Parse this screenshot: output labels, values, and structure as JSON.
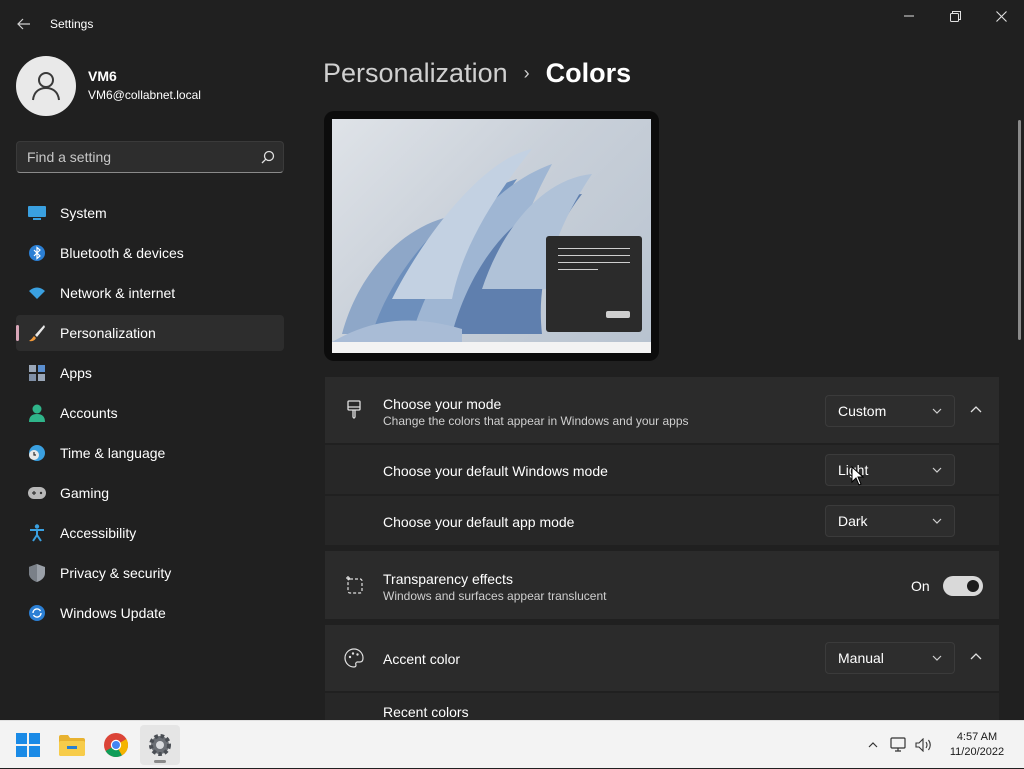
{
  "window": {
    "title": "Settings"
  },
  "user": {
    "name": "VM6",
    "email": "VM6@collabnet.local"
  },
  "search": {
    "placeholder": "Find a setting"
  },
  "sidebar": {
    "items": [
      {
        "label": "System",
        "icon": "monitor-icon"
      },
      {
        "label": "Bluetooth & devices",
        "icon": "bluetooth-icon"
      },
      {
        "label": "Network & internet",
        "icon": "wifi-icon"
      },
      {
        "label": "Personalization",
        "icon": "brush-icon",
        "selected": true
      },
      {
        "label": "Apps",
        "icon": "apps-icon"
      },
      {
        "label": "Accounts",
        "icon": "person-icon"
      },
      {
        "label": "Time & language",
        "icon": "clock-globe-icon"
      },
      {
        "label": "Gaming",
        "icon": "gamepad-icon"
      },
      {
        "label": "Accessibility",
        "icon": "accessibility-icon"
      },
      {
        "label": "Privacy & security",
        "icon": "shield-icon"
      },
      {
        "label": "Windows Update",
        "icon": "update-icon"
      }
    ]
  },
  "breadcrumb": {
    "parent": "Personalization",
    "separator": "›",
    "current": "Colors"
  },
  "settings": {
    "mode": {
      "title": "Choose your mode",
      "description": "Change the colors that appear in Windows and your apps",
      "value": "Custom"
    },
    "windows_mode": {
      "title": "Choose your default Windows mode",
      "value": "Light"
    },
    "app_mode": {
      "title": "Choose your default app mode",
      "value": "Dark"
    },
    "transparency": {
      "title": "Transparency effects",
      "description": "Windows and surfaces appear translucent",
      "state_label": "On",
      "enabled": true
    },
    "accent": {
      "title": "Accent color",
      "value": "Manual"
    },
    "recent_colors": {
      "title": "Recent colors"
    }
  },
  "taskbar": {
    "apps": [
      "start-icon",
      "file-explorer-icon",
      "chrome-icon",
      "settings-icon"
    ],
    "time": "4:57 AM",
    "date": "11/20/2022"
  },
  "colors": {
    "background": "#202020",
    "card": "#2b2b2b",
    "accent_indicator": "#d8a6b8",
    "taskbar": "#f3f3f3"
  }
}
